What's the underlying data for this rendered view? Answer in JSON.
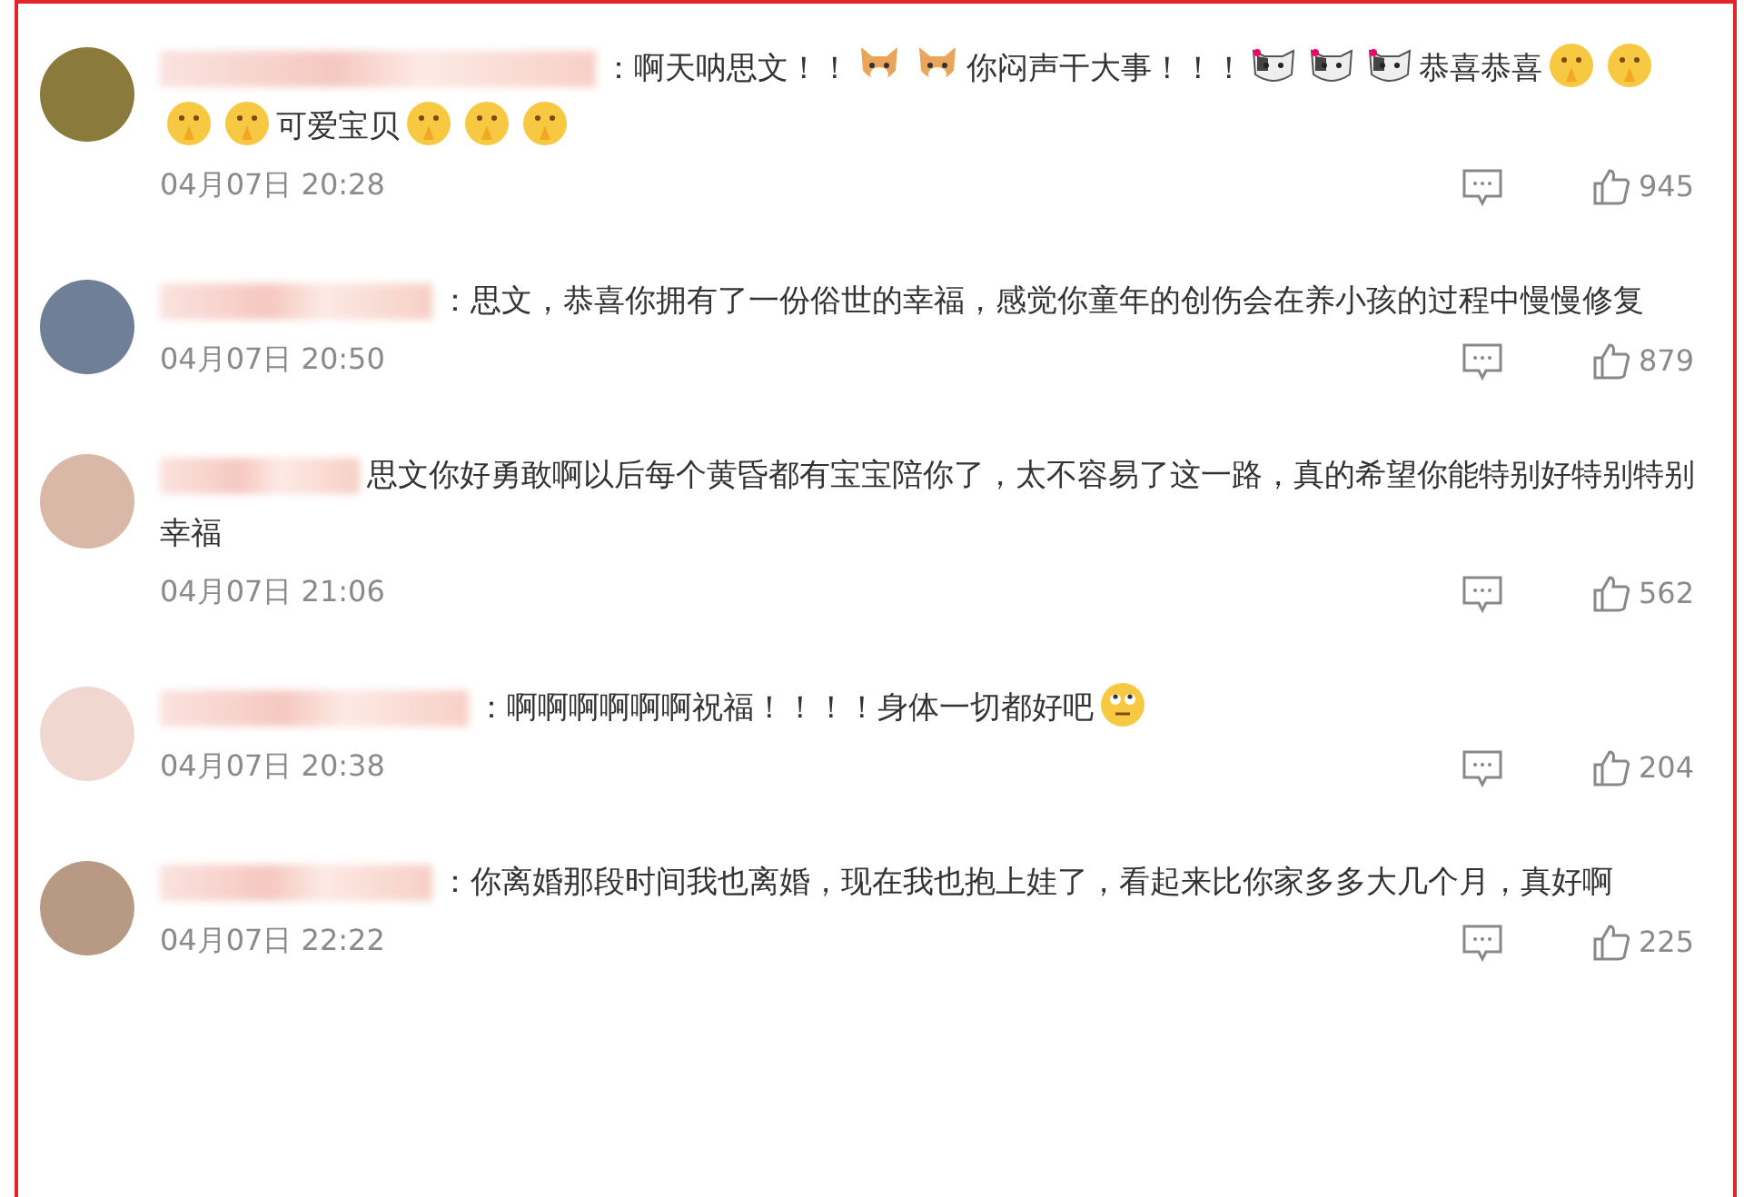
{
  "comments": [
    {
      "segments": [
        {
          "kind": "text",
          "text": "：啊天呐思文！！"
        },
        {
          "kind": "dog"
        },
        {
          "kind": "dog"
        },
        {
          "kind": "text",
          "text": "你闷声干大事！！！"
        },
        {
          "kind": "cat"
        },
        {
          "kind": "cat"
        },
        {
          "kind": "cat"
        },
        {
          "kind": "text",
          "text": "恭喜恭喜"
        },
        {
          "kind": "pray"
        },
        {
          "kind": "pray"
        },
        {
          "kind": "pray"
        },
        {
          "kind": "pray"
        },
        {
          "kind": "text",
          "text": "可爱宝贝"
        },
        {
          "kind": "pray"
        },
        {
          "kind": "pray"
        },
        {
          "kind": "pray"
        }
      ],
      "time": "04月07日 20:28",
      "likes": "945"
    },
    {
      "segments": [
        {
          "kind": "text",
          "text": "：思文，恭喜你拥有了一份俗世的幸福，感觉你童年的创伤会在养小孩的过程中慢慢修复"
        }
      ],
      "time": "04月07日 20:50",
      "likes": "879"
    },
    {
      "segments": [
        {
          "kind": "text",
          "text": "思文你好勇敢啊以后每个黄昏都有宝宝陪你了，太不容易了这一路，真的希望你能特别好特别特别幸福"
        }
      ],
      "time": "04月07日 21:06",
      "likes": "562"
    },
    {
      "segments": [
        {
          "kind": "text",
          "text": "：啊啊啊啊啊啊祝福！！！！身体一切都好吧"
        },
        {
          "kind": "eyeroll"
        }
      ],
      "time": "04月07日 20:38",
      "likes": "204"
    },
    {
      "segments": [
        {
          "kind": "text",
          "text": "：你离婚那段时间我也离婚，现在我也抱上娃了，看起来比你家多多大几个月，真好啊"
        }
      ],
      "time": "04月07日 22:22",
      "likes": "225"
    }
  ]
}
